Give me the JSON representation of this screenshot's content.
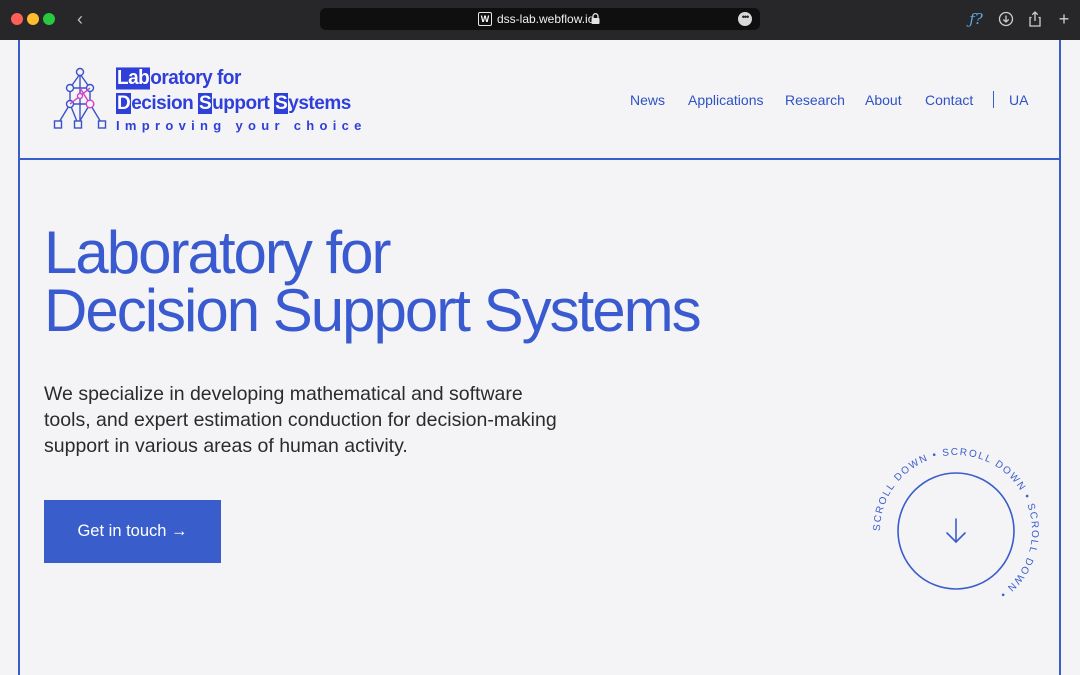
{
  "browser": {
    "url": "dss-lab.webflow.io",
    "favicon_letter": "W"
  },
  "logo": {
    "line1_first": "Lab",
    "line1_rest": "oratory for",
    "line2_d": "D",
    "line2_a": "ecision ",
    "line2_s": "S",
    "line2_b": "upport ",
    "line2_s2": "S",
    "line2_c": "ystems",
    "tagline": "Improving your choice"
  },
  "nav": {
    "items": [
      {
        "label": "News"
      },
      {
        "label": "Applications"
      },
      {
        "label": "Research"
      },
      {
        "label": "About"
      },
      {
        "label": "Contact"
      }
    ],
    "language": "UA"
  },
  "hero": {
    "title_line1": "Laboratory for",
    "title_line2": "Decision Support Systems",
    "description": "We specialize in developing mathematical and software tools, and expert estimation conduction for decision-making support in various areas of human activity.",
    "cta_label": "Get in touch →"
  },
  "scroll_badge": {
    "text": "SCROLL DOWN • SCROLL DOWN • SCROLL DOWN • "
  },
  "colors": {
    "accent": "#3a5dcc",
    "chrome": "#27272a",
    "background": "#f4f4f6"
  }
}
